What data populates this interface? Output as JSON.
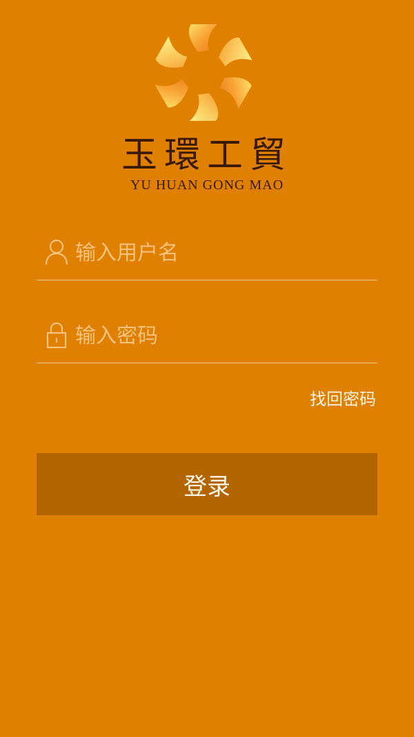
{
  "brand": {
    "name_cn": "玉環工貿",
    "name_en": "YU HUAN GONG MAO"
  },
  "form": {
    "username": {
      "placeholder": "输入用户名",
      "icon": "user-icon"
    },
    "password": {
      "placeholder": "输入密码",
      "icon": "lock-icon"
    },
    "forgot_label": "找回密码",
    "login_label": "登录"
  },
  "colors": {
    "background": "#e08000",
    "button": "#b26500",
    "text": "#fff4e5",
    "placeholder": "#f6c27e",
    "brand_text": "#3a1a06"
  }
}
